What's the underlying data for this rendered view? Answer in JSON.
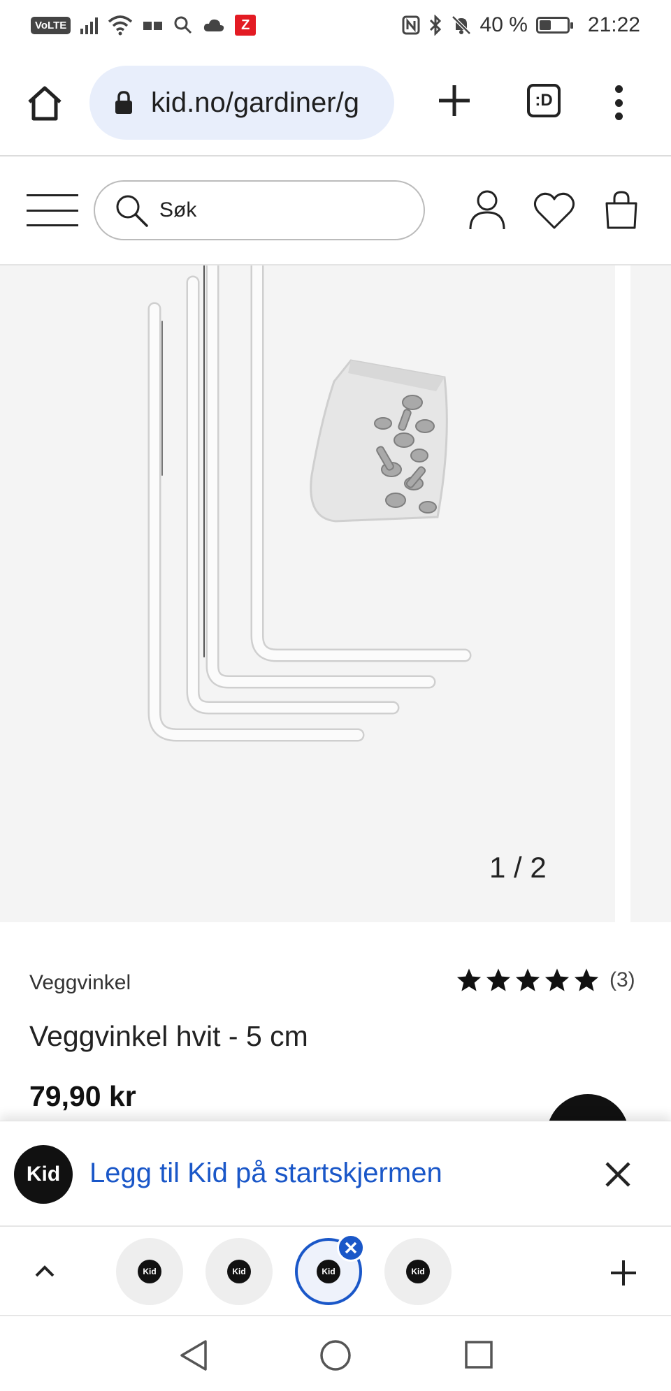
{
  "status_bar": {
    "network_badge": "VoLTE",
    "app_badge": "Z",
    "battery_text": "40 %",
    "battery_level_percent": 40,
    "time": "21:22"
  },
  "browser": {
    "url": "kid.no/gardiner/g",
    "tabs_button_label": ":D"
  },
  "header": {
    "search_placeholder": "Søk"
  },
  "gallery": {
    "counter": "1 / 2"
  },
  "product": {
    "brand": "Veggvinkel",
    "name": "Veggvinkel hvit - 5 cm",
    "price": "79,90 kr",
    "rating_stars": 5,
    "rating_count": "(3)"
  },
  "install_banner": {
    "logo_text": "Kid",
    "text": "Legg til Kid på startskjermen"
  },
  "tab_strip": {
    "tabs": [
      {
        "label": "Kid"
      },
      {
        "label": "Kid"
      },
      {
        "label": "Kid"
      },
      {
        "label": "Kid"
      }
    ]
  },
  "colors": {
    "accent_blue": "#1a57c8",
    "url_bar_bg": "#e8eefb",
    "image_bg": "#f4f4f4",
    "brand_black": "#111111"
  }
}
